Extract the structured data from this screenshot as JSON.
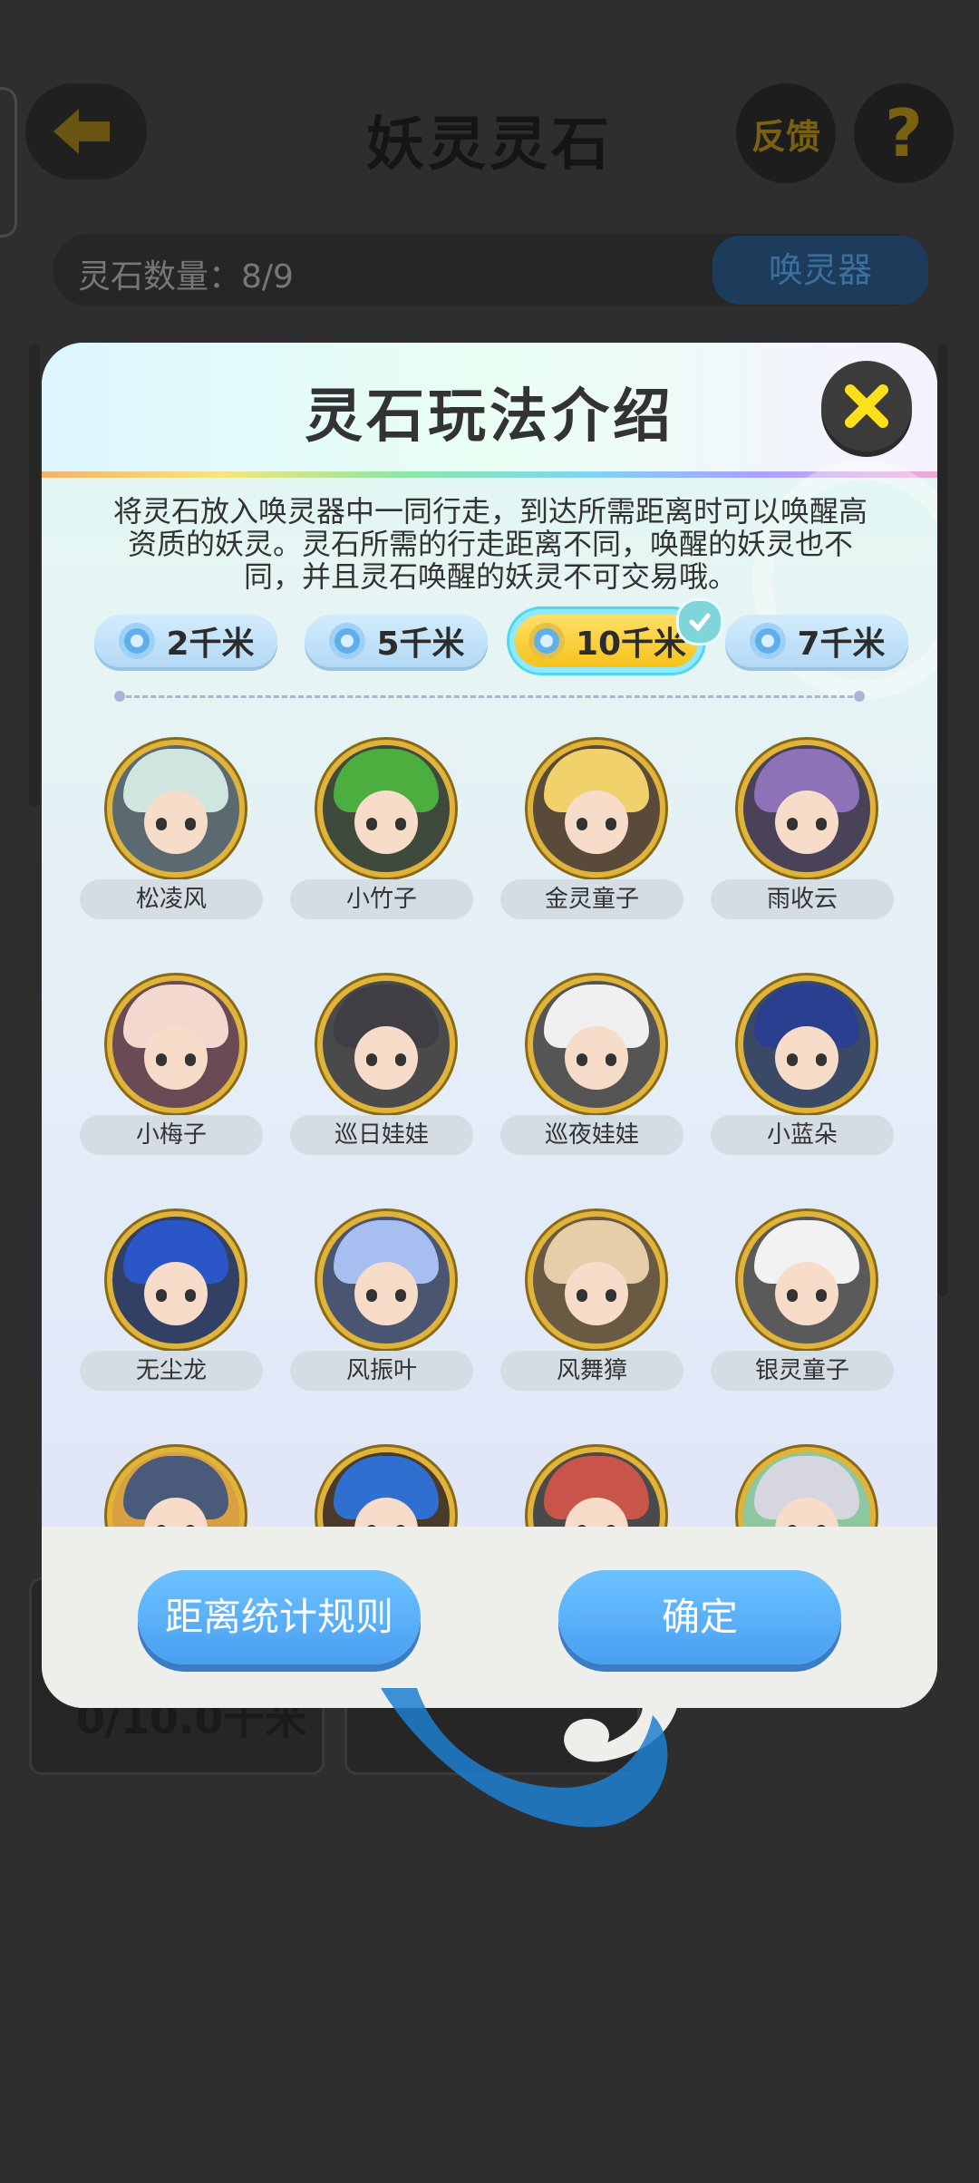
{
  "background": {
    "title": "妖灵灵石",
    "feedback_label": "反馈",
    "help_label": "?",
    "stone_count": "灵石数量：8/9",
    "summon_label": "唤灵器",
    "card_distance": "0/10.0千米"
  },
  "dialog": {
    "title": "灵石玩法介绍",
    "description": "将灵石放入唤灵器中一同行走，到达所需距离时可以唤醒高资质的妖灵。灵石所需的行走距离不同，唤醒的妖灵也不同，并且灵石唤醒的妖灵不可交易哦。",
    "tabs": [
      {
        "label": "2千米",
        "active": false
      },
      {
        "label": "5千米",
        "active": false
      },
      {
        "label": "10千米",
        "active": true
      },
      {
        "label": "7千米",
        "active": false
      }
    ],
    "spirits": [
      {
        "name": "松凌风",
        "hair": "#cfe6e0",
        "bg": "#5a6a70"
      },
      {
        "name": "小竹子",
        "hair": "#4cae3f",
        "bg": "#3f4a3c"
      },
      {
        "name": "金灵童子",
        "hair": "#f1d26a",
        "bg": "#5a4a3a"
      },
      {
        "name": "雨收云",
        "hair": "#8d72b8",
        "bg": "#4a4258"
      },
      {
        "name": "小梅子",
        "hair": "#f3d8cf",
        "bg": "#6a4a55"
      },
      {
        "name": "巡日娃娃",
        "hair": "#3e3e44",
        "bg": "#4a4a4a"
      },
      {
        "name": "巡夜娃娃",
        "hair": "#f0f0f0",
        "bg": "#555"
      },
      {
        "name": "小蓝朵",
        "hair": "#2a3f8f",
        "bg": "#3a4a66"
      },
      {
        "name": "无尘龙",
        "hair": "#2a56c8",
        "bg": "#334066"
      },
      {
        "name": "风振叶",
        "hair": "#a7bff0",
        "bg": "#4a5572"
      },
      {
        "name": "风舞獐",
        "hair": "#e6cfa8",
        "bg": "#6a5a44"
      },
      {
        "name": "银灵童子",
        "hair": "#f2f2f2",
        "bg": "#5a5a5a"
      },
      {
        "name": "",
        "hair": "#4a5a7a",
        "bg": "#d8a040"
      },
      {
        "name": "",
        "hair": "#2f6fd0",
        "bg": "#4a3a2a"
      },
      {
        "name": "",
        "hair": "#c9544a",
        "bg": "#4a4a4a"
      },
      {
        "name": "",
        "hair": "#d6d6e0",
        "bg": "#8cc7a0"
      }
    ],
    "rules_button": "距离统计规则",
    "confirm_button": "确定"
  },
  "colors": {
    "accent_blue": "#4a9ff1",
    "gold": "#e0b33a",
    "active_tab": "#f6c21c"
  }
}
